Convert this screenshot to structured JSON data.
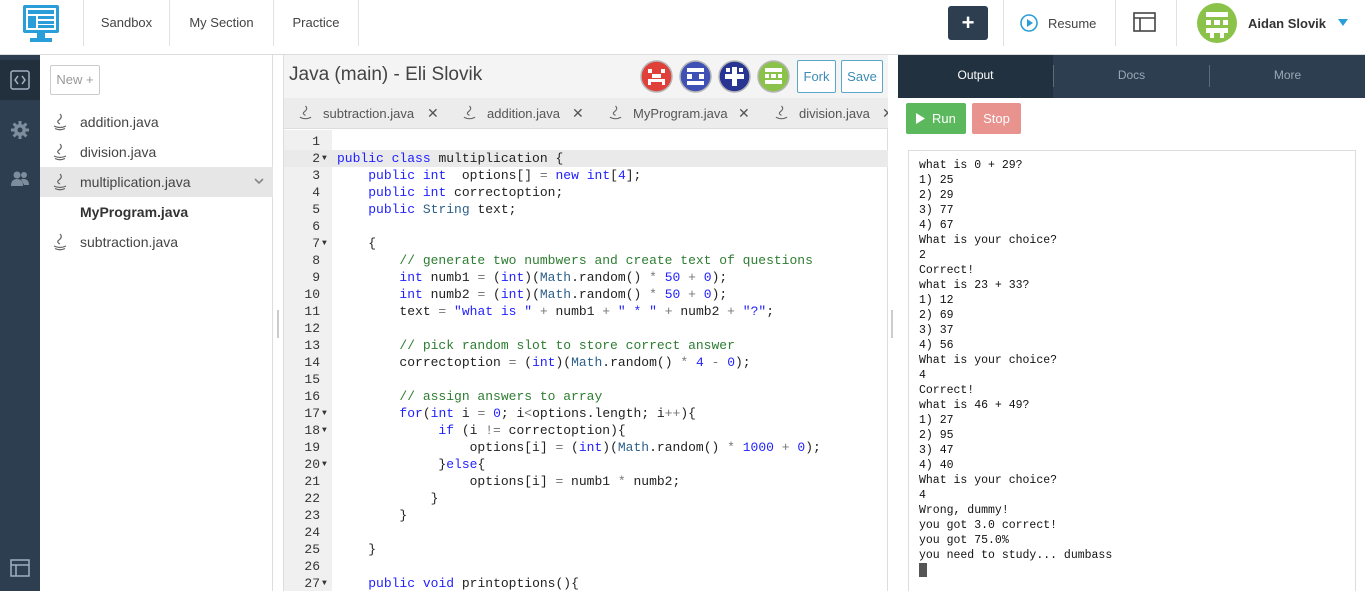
{
  "topbar": {
    "nav": [
      "Sandbox",
      "My Section",
      "Practice"
    ],
    "plus_label": "+",
    "resume_label": "Resume",
    "username": "Aidan Slovik"
  },
  "sidebar": {
    "new_label": "New +",
    "files": [
      {
        "name": "addition.java"
      },
      {
        "name": "division.java"
      },
      {
        "name": "multiplication.java"
      },
      {
        "name": "MyProgram.java"
      },
      {
        "name": "subtraction.java"
      }
    ]
  },
  "editor": {
    "title": "Java (main) - Eli Slovik",
    "fork_label": "Fork",
    "save_label": "Save",
    "tabs": [
      "subtraction.java",
      "addition.java",
      "MyProgram.java",
      "division.java"
    ],
    "close_glyph": "✕",
    "line_numbers": [
      "1",
      "2",
      "3",
      "4",
      "5",
      "6",
      "7",
      "8",
      "9",
      "10",
      "11",
      "12",
      "13",
      "14",
      "15",
      "16",
      "17",
      "18",
      "19",
      "20",
      "21",
      "22",
      "23",
      "24",
      "25",
      "26",
      "27"
    ]
  },
  "output": {
    "tabs": [
      "Output",
      "Docs",
      "More"
    ],
    "run_label": "Run",
    "stop_label": "Stop",
    "lines": [
      "what is 0 + 29?",
      "1) 25",
      "2) 29",
      "3) 77",
      "4) 67",
      "What is your choice?",
      "2",
      "Correct!",
      "what is 23 + 33?",
      "1) 12",
      "2) 69",
      "3) 37",
      "4) 56",
      "What is your choice?",
      "4",
      "Correct!",
      "what is 46 + 49?",
      "1) 27",
      "2) 95",
      "3) 47",
      "4) 40",
      "What is your choice?",
      "4",
      "Wrong, dummy!",
      "you got 3.0 correct!",
      "you got 75.0%",
      "you need to study... dumbass"
    ]
  },
  "colors": {
    "rail": "#2c3e50",
    "run": "#5cb85c",
    "stop": "#e9938f",
    "accent": "#3b8bb5"
  }
}
